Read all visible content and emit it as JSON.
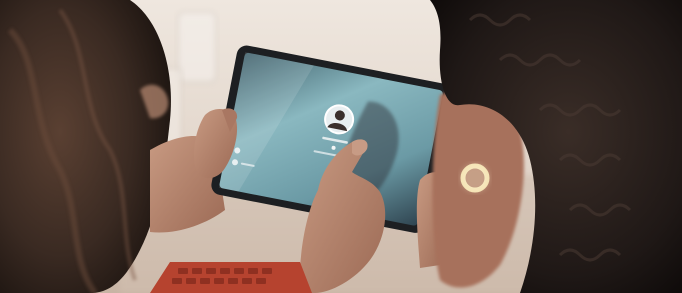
{
  "scene": {
    "description_icons": [
      "tablet-icon",
      "avatar-icon",
      "lock-icon",
      "wifi-icon",
      "power-icon"
    ],
    "colors": {
      "background_wall": "#e6ddd4",
      "table": "#cbb9aa",
      "tablet_bezel": "#1d1f22",
      "tablet_screen": "#6f9fa8",
      "skin": "#b78670",
      "hair_left": "#3a2a22",
      "hair_right": "#1f1816",
      "keyboard": "#b6432f"
    }
  }
}
